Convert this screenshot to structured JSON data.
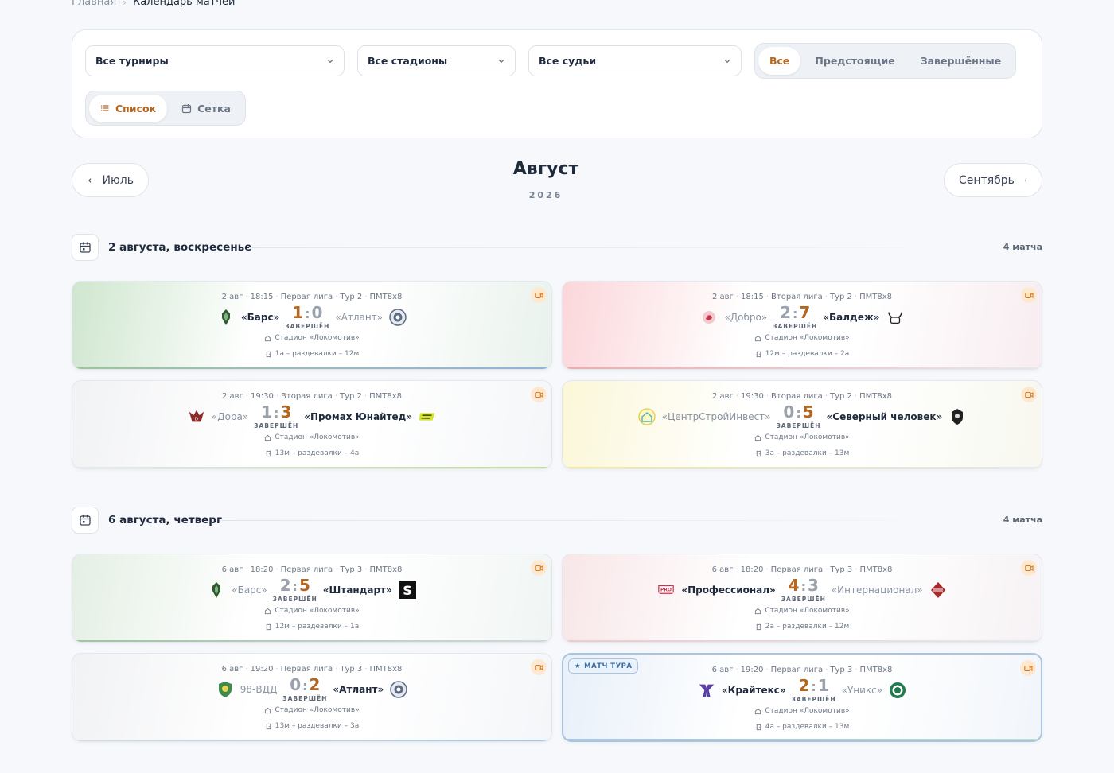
{
  "breadcrumb": {
    "home": "Главная",
    "current": "Календарь матчей"
  },
  "filters": {
    "tournament": "Все турниры",
    "stadium": "Все стадионы",
    "referee": "Все судьи",
    "status_options": [
      "Все",
      "Предстоящие",
      "Завершённые"
    ],
    "status_active": "Все",
    "view_options": [
      "Список",
      "Сетка"
    ],
    "view_active": "Список"
  },
  "month_nav": {
    "prev": "Июль",
    "title": "Август",
    "year": "2026",
    "next": "Сентябрь"
  },
  "colors": {
    "accent": "#b5651d",
    "featured": "#a9c4e0"
  },
  "days": [
    {
      "label": "2 августа, воскресенье",
      "count": "4 матча",
      "matches": [
        {
          "date": "2 авг",
          "time": "18:15",
          "league": "Первая лига",
          "round": "Тур 2",
          "format": "ПМТ8х8",
          "home": "«Барс»",
          "away": "«Атлант»",
          "home_score": "1",
          "away_score": "0",
          "winner": "home",
          "status": "ЗАВЕРШЁН",
          "stadium": "Стадион «Локомотив»",
          "rooms": "1а – раздевалки – 12м",
          "home_logo": "bars-logo",
          "away_logo": "atlant-logo",
          "tint": "#cfe6cf",
          "bar": "#9cc79c",
          "bar2": "#8fb3df"
        },
        {
          "date": "2 авг",
          "time": "18:15",
          "league": "Вторая лига",
          "round": "Тур 2",
          "format": "ПМТ8х8",
          "home": "«Добро»",
          "away": "«Балдеж»",
          "home_score": "2",
          "away_score": "7",
          "winner": "away",
          "status": "ЗАВЕРШЁН",
          "stadium": "Стадион «Локомотив»",
          "rooms": "12м – раздевалки – 2а",
          "home_logo": "dobro-logo",
          "away_logo": "baldezh-logo",
          "tint": "#fbd6da",
          "bar": "#f2a9b0",
          "bar2": "#e6e8ec"
        },
        {
          "date": "2 авг",
          "time": "19:30",
          "league": "Вторая лига",
          "round": "Тур 2",
          "format": "ПМТ8х8",
          "home": "«Дора»",
          "away": "«Промах Юнайтед»",
          "home_score": "1",
          "away_score": "3",
          "winner": "away",
          "status": "ЗАВЕРШЁН",
          "stadium": "Стадион «Локомотив»",
          "rooms": "13м – раздевалки – 4а",
          "home_logo": "dora-logo",
          "away_logo": "promah-logo",
          "tint": "#f1f2f4",
          "bar": "#e6e8ec",
          "bar2": "#c7d99a"
        },
        {
          "date": "2 авг",
          "time": "19:30",
          "league": "Вторая лига",
          "round": "Тур 2",
          "format": "ПМТ8х8",
          "home": "«ЦентрСтройИнвест»",
          "away": "«Северный человек»",
          "home_score": "0",
          "away_score": "5",
          "winner": "away",
          "status": "ЗАВЕРШЁН",
          "stadium": "Стадион «Локомотив»",
          "rooms": "3а – раздевалки – 13м",
          "home_logo": "csi-logo",
          "away_logo": "sever-logo",
          "tint": "#fbf7d8",
          "bar": "#f3e8a0",
          "bar2": "#e6e8ec"
        }
      ]
    },
    {
      "label": "6 августа, четверг",
      "count": "4 матча",
      "matches": [
        {
          "date": "6 авг",
          "time": "18:20",
          "league": "Первая лига",
          "round": "Тур 3",
          "format": "ПМТ8х8",
          "home": "«Барс»",
          "away": "«Штандарт»",
          "home_score": "2",
          "away_score": "5",
          "winner": "away",
          "status": "ЗАВЕРШЁН",
          "stadium": "Стадион «Локомотив»",
          "rooms": "12м – раздевалки – 1а",
          "home_logo": "bars-logo",
          "away_logo": "standart-logo",
          "tint": "#e4efe4",
          "bar": "#9cc79c",
          "bar2": "#d4d8de"
        },
        {
          "date": "6 авг",
          "time": "18:20",
          "league": "Первая лига",
          "round": "Тур 3",
          "format": "ПМТ8х8",
          "home": "«Профессионал»",
          "away": "«Интернационал»",
          "home_score": "4",
          "away_score": "3",
          "winner": "home",
          "status": "ЗАВЕРШЁН",
          "stadium": "Стадион «Локомотив»",
          "rooms": "2а – раздевалки – 12м",
          "home_logo": "prof-logo",
          "away_logo": "inter-logo",
          "tint": "#f8e6e8",
          "bar": "#f0c8cc",
          "bar2": "#e6e8ec"
        },
        {
          "date": "6 авг",
          "time": "19:20",
          "league": "Первая лига",
          "round": "Тур 3",
          "format": "ПМТ8х8",
          "home": "98-ВДД",
          "away": "«Атлант»",
          "home_score": "0",
          "away_score": "2",
          "winner": "away",
          "status": "ЗАВЕРШЁН",
          "stadium": "Стадион «Локомотив»",
          "rooms": "13м – раздевалки – 3а",
          "home_logo": "vdd-logo",
          "away_logo": "atlant-logo",
          "tint": "#f1f2f4",
          "bar": "#d9dce2",
          "bar2": "#a9c4e0"
        },
        {
          "date": "6 авг",
          "time": "19:20",
          "league": "Первая лига",
          "round": "Тур 3",
          "format": "ПМТ8х8",
          "home": "«Крайтекс»",
          "away": "«Уникс»",
          "home_score": "2",
          "away_score": "1",
          "winner": "home",
          "status": "ЗАВЕРШЁН",
          "stadium": "Стадион «Локомотив»",
          "rooms": "4а – раздевалки – 13м",
          "home_logo": "krajteks-logo",
          "away_logo": "uniks-logo",
          "tint": "#e8f0f9",
          "bar": "#a9c4e0",
          "bar2": "#bfe0cf",
          "featured": true,
          "badge": "МАТЧ ТУРА"
        }
      ]
    }
  ]
}
